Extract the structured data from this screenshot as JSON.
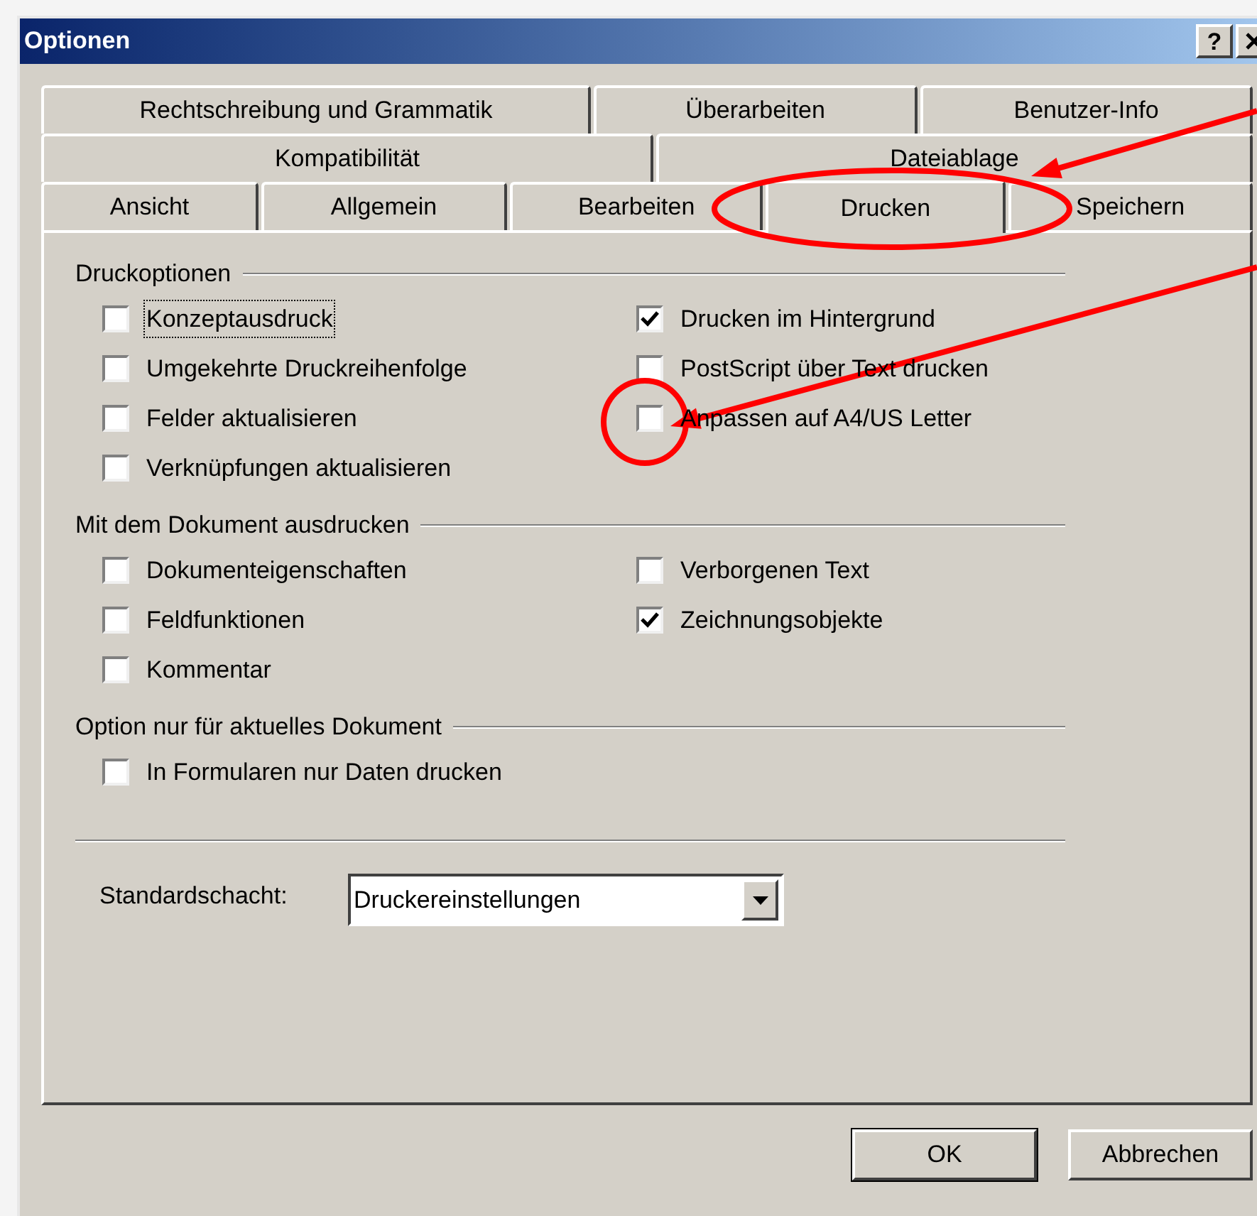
{
  "window": {
    "title": "Optionen",
    "help_button": "?"
  },
  "tab_rows": [
    [
      {
        "label": "Rechtschreibung und Grammatik",
        "selected": false
      },
      {
        "label": "Überarbeiten",
        "selected": false
      },
      {
        "label": "Benutzer-Info",
        "selected": false
      }
    ],
    [
      {
        "label": "Kompatibilität",
        "selected": false
      },
      {
        "label": "Dateiablage",
        "selected": false
      }
    ],
    [
      {
        "label": "Ansicht",
        "selected": false
      },
      {
        "label": "Allgemein",
        "selected": false
      },
      {
        "label": "Bearbeiten",
        "selected": false
      },
      {
        "label": "Drucken",
        "selected": true
      },
      {
        "label": "Speichern",
        "selected": false
      }
    ]
  ],
  "sections": [
    {
      "title": "Druckoptionen",
      "columns": [
        [
          {
            "label": "Konzeptausdruck",
            "checked": false,
            "focused": true
          },
          {
            "label": "Umgekehrte Druckreihenfolge",
            "checked": false,
            "focused": false
          },
          {
            "label": "Felder aktualisieren",
            "checked": false,
            "focused": false
          },
          {
            "label": "Verknüpfungen aktualisieren",
            "checked": false,
            "focused": false
          }
        ],
        [
          {
            "label": "Drucken im Hintergrund",
            "checked": true,
            "focused": false
          },
          {
            "label": "PostScript über Text drucken",
            "checked": false,
            "focused": false
          },
          {
            "label": "Anpassen auf A4/US Letter",
            "checked": false,
            "focused": false
          }
        ]
      ]
    },
    {
      "title": "Mit dem Dokument ausdrucken",
      "columns": [
        [
          {
            "label": "Dokumenteigenschaften",
            "checked": false,
            "focused": false
          },
          {
            "label": "Feldfunktionen",
            "checked": false,
            "focused": false
          },
          {
            "label": "Kommentar",
            "checked": false,
            "focused": false
          }
        ],
        [
          {
            "label": "Verborgenen Text",
            "checked": false,
            "focused": false
          },
          {
            "label": "Zeichnungsobjekte",
            "checked": true,
            "focused": false
          }
        ]
      ]
    },
    {
      "title": "Option nur für aktuelles Dokument",
      "columns": [
        [
          {
            "label": "In Formularen nur Daten drucken",
            "checked": false,
            "focused": false
          }
        ]
      ]
    }
  ],
  "default_tray": {
    "label": "Standardschacht:",
    "value": "Druckereinstellungen"
  },
  "buttons": [
    {
      "label": "OK",
      "default": true
    },
    {
      "label": "Abbrechen",
      "default": false
    }
  ],
  "annotations": [
    {
      "kind": "ellipse"
    },
    {
      "kind": "circle"
    },
    {
      "kind": "arrow"
    },
    {
      "kind": "arrow"
    }
  ]
}
